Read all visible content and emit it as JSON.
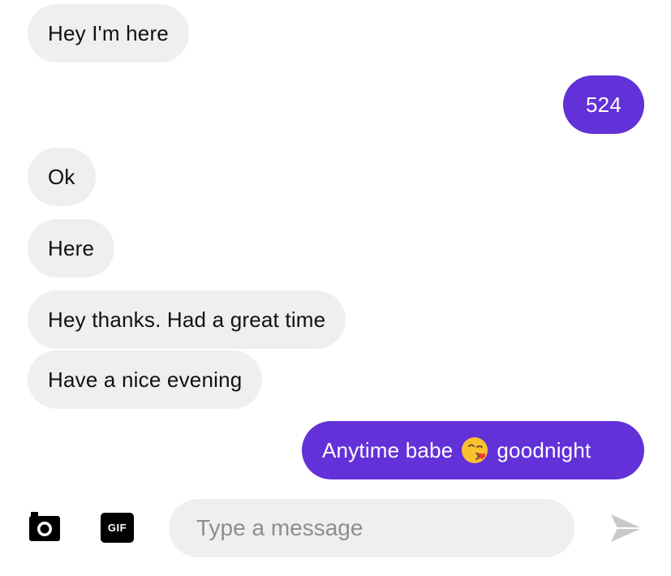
{
  "messages": [
    {
      "direction": "incoming",
      "text": "Hey I'm here"
    },
    {
      "direction": "outgoing",
      "text": "524"
    },
    {
      "direction": "incoming",
      "text": "Ok"
    },
    {
      "direction": "incoming",
      "text": "Here"
    },
    {
      "direction": "incoming",
      "text": "Hey thanks. Had a great time"
    },
    {
      "direction": "incoming",
      "text": "Have a nice evening"
    },
    {
      "direction": "outgoing",
      "text_before_emoji": "Anytime babe",
      "emoji": "face-blowing-a-kiss-icon",
      "text_after_emoji": "goodnight"
    }
  ],
  "composer": {
    "camera_icon": "camera-icon",
    "gif_label": "GIF",
    "input_placeholder": "Type a message",
    "input_value": "",
    "send_icon": "send-icon"
  },
  "colors": {
    "incoming_bubble": "#efefef",
    "outgoing_bubble": "#6231d8",
    "send_icon": "#c7c7cc"
  }
}
